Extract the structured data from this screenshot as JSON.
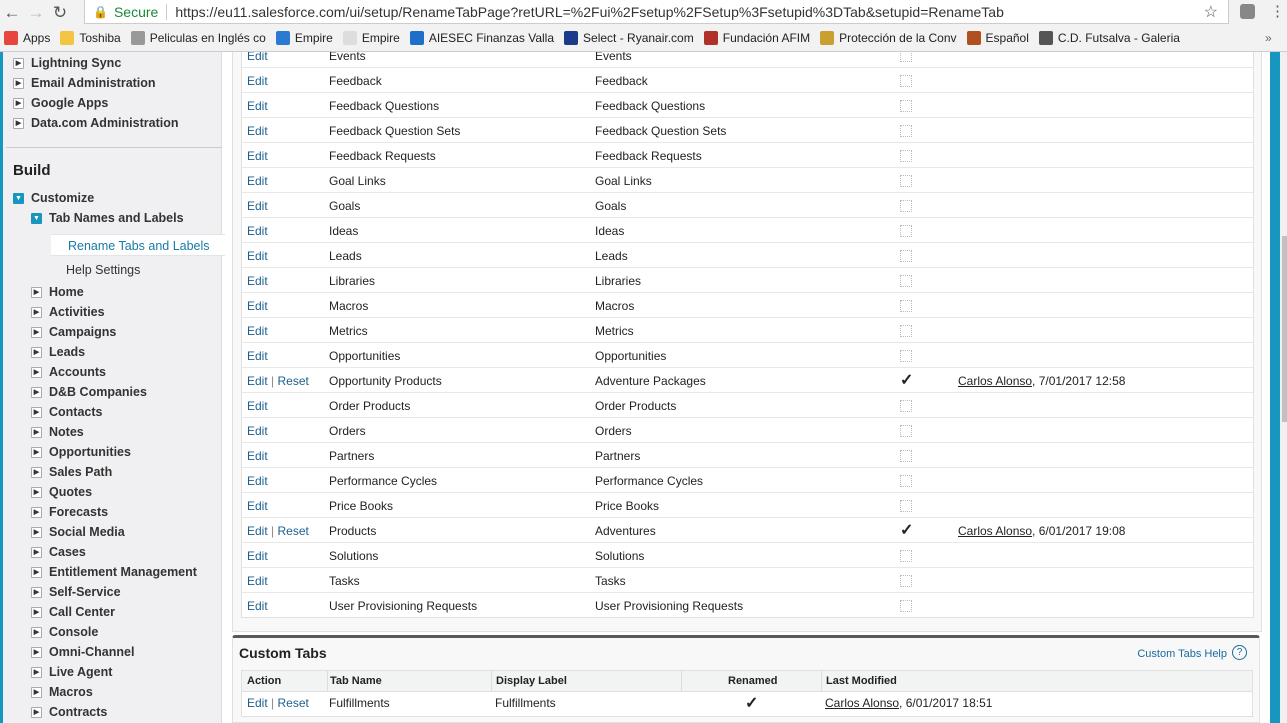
{
  "browser": {
    "secure_label": "Secure",
    "url": "https://eu11.salesforce.com/ui/setup/RenameTabPage?retURL=%2Fui%2Fsetup%2FSetup%3Fsetupid%3DTab&setupid=RenameTab",
    "bookmarks": [
      {
        "label": "Apps",
        "color": "#e8453c"
      },
      {
        "label": "Toshiba",
        "color": "#f4c542"
      },
      {
        "label": "Peliculas en Inglés co",
        "color": "#999999"
      },
      {
        "label": "Empire",
        "color": "#2a7ad1"
      },
      {
        "label": "Empire",
        "color": "#dddddd"
      },
      {
        "label": "AIESEC Finanzas Valla",
        "color": "#1e6fc9"
      },
      {
        "label": "Select - Ryanair.com",
        "color": "#1b3a8a"
      },
      {
        "label": "Fundación AFIM",
        "color": "#b0302a"
      },
      {
        "label": "Protección de la Conv",
        "color": "#c8a030"
      },
      {
        "label": "Español",
        "color": "#b05020"
      },
      {
        "label": "C.D. Futsalva - Galeria",
        "color": "#555555"
      }
    ]
  },
  "sidebar": {
    "top_items": [
      "Lightning Sync",
      "Email Administration",
      "Google Apps",
      "Data.com Administration"
    ],
    "build_heading": "Build",
    "customize": "Customize",
    "tab_names": "Tab Names and Labels",
    "rename_tabs": "Rename Tabs and Labels",
    "help_settings": "Help Settings",
    "items": [
      "Home",
      "Activities",
      "Campaigns",
      "Leads",
      "Accounts",
      "D&B Companies",
      "Contacts",
      "Notes",
      "Opportunities",
      "Sales Path",
      "Quotes",
      "Forecasts",
      "Social Media",
      "Cases",
      "Entitlement Management",
      "Self-Service",
      "Call Center",
      "Console",
      "Omni-Channel",
      "Live Agent",
      "Macros",
      "Contracts"
    ]
  },
  "standard_tabs": {
    "edit": "Edit",
    "reset": "Reset",
    "sep": "|",
    "rows": [
      {
        "name": "Events",
        "label": "Events",
        "renamed": false
      },
      {
        "name": "Feedback",
        "label": "Feedback",
        "renamed": false
      },
      {
        "name": "Feedback Questions",
        "label": "Feedback Questions",
        "renamed": false
      },
      {
        "name": "Feedback Question Sets",
        "label": "Feedback Question Sets",
        "renamed": false
      },
      {
        "name": "Feedback Requests",
        "label": "Feedback Requests",
        "renamed": false
      },
      {
        "name": "Goal Links",
        "label": "Goal Links",
        "renamed": false
      },
      {
        "name": "Goals",
        "label": "Goals",
        "renamed": false
      },
      {
        "name": "Ideas",
        "label": "Ideas",
        "renamed": false
      },
      {
        "name": "Leads",
        "label": "Leads",
        "renamed": false
      },
      {
        "name": "Libraries",
        "label": "Libraries",
        "renamed": false
      },
      {
        "name": "Macros",
        "label": "Macros",
        "renamed": false
      },
      {
        "name": "Metrics",
        "label": "Metrics",
        "renamed": false
      },
      {
        "name": "Opportunities",
        "label": "Opportunities",
        "renamed": false
      },
      {
        "name": "Opportunity Products",
        "label": "Adventure Packages",
        "renamed": true,
        "modified_by": "Carlos Alonso",
        "modified_at": ", 7/01/2017 12:58"
      },
      {
        "name": "Order Products",
        "label": "Order Products",
        "renamed": false
      },
      {
        "name": "Orders",
        "label": "Orders",
        "renamed": false
      },
      {
        "name": "Partners",
        "label": "Partners",
        "renamed": false
      },
      {
        "name": "Performance Cycles",
        "label": "Performance Cycles",
        "renamed": false
      },
      {
        "name": "Price Books",
        "label": "Price Books",
        "renamed": false
      },
      {
        "name": "Products",
        "label": "Adventures",
        "renamed": true,
        "modified_by": "Carlos Alonso",
        "modified_at": ", 6/01/2017 19:08"
      },
      {
        "name": "Solutions",
        "label": "Solutions",
        "renamed": false
      },
      {
        "name": "Tasks",
        "label": "Tasks",
        "renamed": false
      },
      {
        "name": "User Provisioning Requests",
        "label": "User Provisioning Requests",
        "renamed": false
      }
    ]
  },
  "custom_tabs": {
    "title": "Custom Tabs",
    "help": "Custom Tabs Help",
    "help_icon": "?",
    "headers": {
      "action": "Action",
      "tab_name": "Tab Name",
      "display_label": "Display Label",
      "renamed": "Renamed",
      "last_modified": "Last Modified"
    },
    "row": {
      "edit": "Edit",
      "sep": "|",
      "reset": "Reset",
      "tab_name": "Fulfillments",
      "display_label": "Fulfillments",
      "check": "✓",
      "modified_by": "Carlos Alonso",
      "modified_at": ", 6/01/2017 18:51"
    }
  }
}
